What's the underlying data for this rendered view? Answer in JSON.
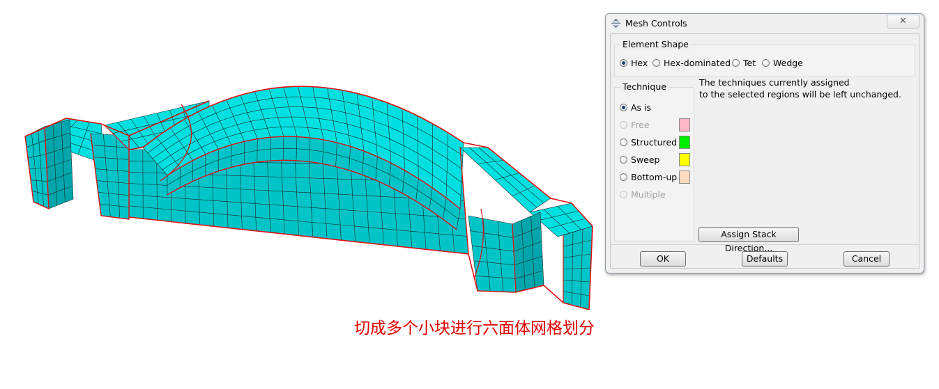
{
  "caption": "切成多个小块进行六面体网格划分",
  "dialog": {
    "title": "Mesh Controls",
    "close_symbol": "✕",
    "element_shape": {
      "legend": "Element Shape",
      "options": [
        {
          "label": "Hex",
          "selected": true
        },
        {
          "label": "Hex-dominated",
          "selected": false
        },
        {
          "label": "Tet",
          "selected": false
        },
        {
          "label": "Wedge",
          "selected": false
        }
      ]
    },
    "technique": {
      "legend": "Technique",
      "options": [
        {
          "label": "As is",
          "selected": true,
          "enabled": true
        },
        {
          "label": "Free",
          "selected": false,
          "enabled": false,
          "color": "#ffb6c8"
        },
        {
          "label": "Structured",
          "selected": false,
          "enabled": true,
          "color": "#00ee00"
        },
        {
          "label": "Sweep",
          "selected": false,
          "enabled": true,
          "color": "#ffff00"
        },
        {
          "label": "Bottom-up",
          "selected": false,
          "enabled": true,
          "color": "#ffdcc0"
        },
        {
          "label": "Multiple",
          "selected": false,
          "enabled": false
        }
      ],
      "description_line1": "The techniques currently assigned",
      "description_line2": "to the selected regions will be left unchanged.",
      "assign_stack_label": "Assign Stack Direction..."
    },
    "buttons": {
      "ok": "OK",
      "defaults": "Defaults",
      "cancel": "Cancel"
    }
  },
  "colors": {
    "mesh_fill": "#00e0e0",
    "mesh_side": "#00c4c8",
    "mesh_dark": "#00a6ac",
    "partition_edge": "#e01010",
    "grid_line": "#1a2a2a",
    "caption": "#e30000"
  }
}
